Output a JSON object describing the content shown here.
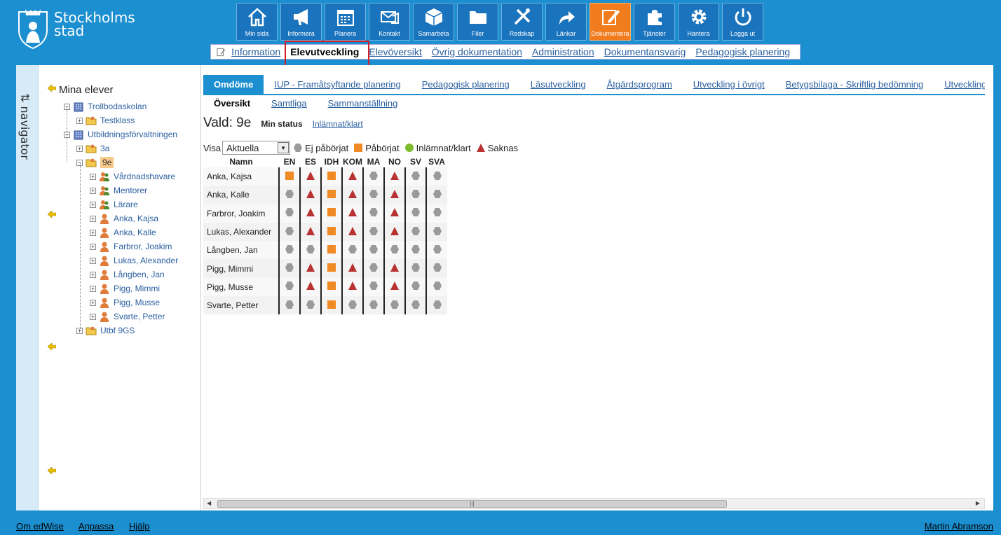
{
  "brand": {
    "line1": "Stockholms",
    "line2": "stad"
  },
  "toolbar": [
    {
      "label": "Min sida",
      "icon": "home-icon"
    },
    {
      "label": "Informera",
      "icon": "megaphone-icon"
    },
    {
      "label": "Planera",
      "icon": "calendar-icon"
    },
    {
      "label": "Kontakt",
      "icon": "mail-icon"
    },
    {
      "label": "Samarbeta",
      "icon": "cube-icon"
    },
    {
      "label": "Filer",
      "icon": "folder-icon"
    },
    {
      "label": "Redskap",
      "icon": "tools-icon"
    },
    {
      "label": "Länkar",
      "icon": "share-arrow-icon"
    },
    {
      "label": "Dokumentera",
      "icon": "edit-icon",
      "active": true
    },
    {
      "label": "Tjänster",
      "icon": "puzzle-icon"
    },
    {
      "label": "Hantera",
      "icon": "gear-icon"
    },
    {
      "label": "Logga ut",
      "icon": "power-icon"
    }
  ],
  "subnav": [
    "Information",
    "Elevutveckling",
    "Elevöversikt",
    "Övrig dokumentation",
    "Administration",
    "Dokumentansvarig",
    "Pedagogisk planering"
  ],
  "navigator_label": "navigator",
  "tree": {
    "root": "Mina elever",
    "nodes": [
      {
        "label": "Trollbodaskolan",
        "level": 1,
        "icon": "school-icon"
      },
      {
        "label": "Testklass",
        "level": 2,
        "icon": "class-folder-icon"
      },
      {
        "label": "Utbildningsförvaltningen",
        "level": 1,
        "icon": "school-icon"
      },
      {
        "label": "3a",
        "level": 2,
        "icon": "class-folder-icon"
      },
      {
        "label": "9e",
        "level": 2,
        "icon": "class-folder-icon",
        "selected": true
      },
      {
        "label": "Vårdnadshavare",
        "level": 3,
        "icon": "group-icon"
      },
      {
        "label": "Mentorer",
        "level": 3,
        "icon": "group-icon"
      },
      {
        "label": "Lärare",
        "level": 3,
        "icon": "group-icon"
      },
      {
        "label": "Anka, Kajsa",
        "level": 3,
        "icon": "person-icon"
      },
      {
        "label": "Anka, Kalle",
        "level": 3,
        "icon": "person-icon"
      },
      {
        "label": "Farbror, Joakim",
        "level": 3,
        "icon": "person-icon"
      },
      {
        "label": "Lukas, Alexander",
        "level": 3,
        "icon": "person-icon"
      },
      {
        "label": "Långben, Jan",
        "level": 3,
        "icon": "person-icon"
      },
      {
        "label": "Pigg, Mimmi",
        "level": 3,
        "icon": "person-icon"
      },
      {
        "label": "Pigg, Musse",
        "level": 3,
        "icon": "person-icon"
      },
      {
        "label": "Svarte, Petter",
        "level": 3,
        "icon": "person-icon"
      },
      {
        "label": "Utbf 9GS",
        "level": 2,
        "icon": "class-folder-icon"
      }
    ]
  },
  "tabs": [
    "Omdöme",
    "IUP - Framåtsyftande planering",
    "Pedagogisk planering",
    "Läsutveckling",
    "Åtgärdsprogram",
    "Utveckling i övrigt",
    "Betygsbilaga - Skriftlig bedömning",
    "Utvecklingss"
  ],
  "subtabs": [
    "Översikt",
    "Samtliga",
    "Sammanställning"
  ],
  "vald": "Vald: 9e",
  "min_status": "Min status",
  "inlamnat_link": "Inlämnat/klart",
  "visa_label": "Visa",
  "visa_value": "Aktuella",
  "legend": {
    "ej": "Ej påbörjat",
    "pab": "Påbörjat",
    "inl": "Inlämnat/klart",
    "sak": "Saknas"
  },
  "status_colors": {
    "ej": "#9a9a9a",
    "pab": "#f08a24",
    "inl": "#7dbb2e",
    "sak": "#b83232"
  },
  "table": {
    "name_header": "Namn",
    "subjects": [
      "EN",
      "ES",
      "IDH",
      "KOM",
      "MA",
      "NO",
      "SV",
      "SVA"
    ],
    "rows": [
      {
        "name": "Anka, Kajsa",
        "status": [
          "pab",
          "sak",
          "pab",
          "sak",
          "ej",
          "sak",
          "ej",
          "ej"
        ]
      },
      {
        "name": "Anka, Kalle",
        "status": [
          "ej",
          "sak",
          "pab",
          "sak",
          "ej",
          "sak",
          "ej",
          "ej"
        ]
      },
      {
        "name": "Farbror, Joakim",
        "status": [
          "ej",
          "sak",
          "pab",
          "sak",
          "ej",
          "sak",
          "ej",
          "ej"
        ]
      },
      {
        "name": "Lukas, Alexander",
        "status": [
          "ej",
          "sak",
          "pab",
          "sak",
          "ej",
          "sak",
          "ej",
          "ej"
        ]
      },
      {
        "name": "Långben, Jan",
        "status": [
          "ej",
          "ej",
          "pab",
          "ej",
          "ej",
          "ej",
          "ej",
          "ej"
        ]
      },
      {
        "name": "Pigg, Mimmi",
        "status": [
          "ej",
          "sak",
          "pab",
          "sak",
          "ej",
          "sak",
          "ej",
          "ej"
        ]
      },
      {
        "name": "Pigg, Musse",
        "status": [
          "ej",
          "sak",
          "pab",
          "sak",
          "ej",
          "sak",
          "ej",
          "ej"
        ]
      },
      {
        "name": "Svarte, Petter",
        "status": [
          "ej",
          "ej",
          "pab",
          "ej",
          "ej",
          "ej",
          "ej",
          "ej"
        ]
      }
    ]
  },
  "footer": {
    "links": [
      "Om edWise",
      "Anpassa",
      "Hjälp"
    ],
    "user": "Martin Abramson"
  }
}
